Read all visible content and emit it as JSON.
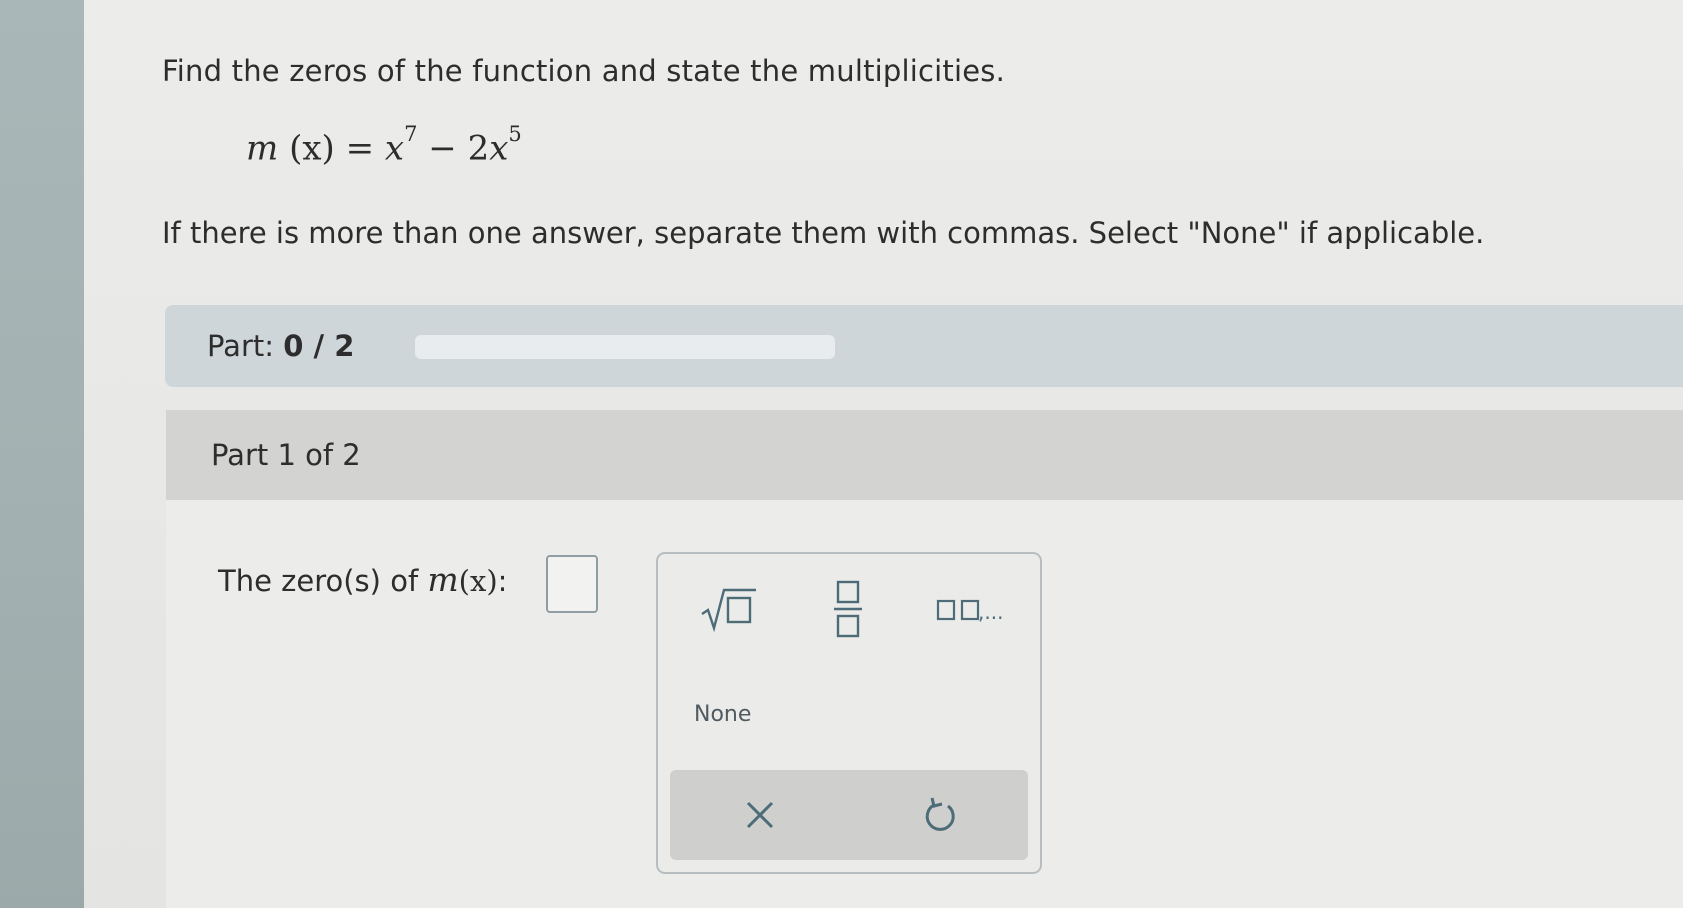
{
  "question": {
    "prompt": "Find the zeros of the function and state the multiplicities.",
    "function_name": "m",
    "function_var": "(x)",
    "equals": "=",
    "term1_base": "x",
    "term1_exp": "7",
    "minus": "−",
    "term2_coef": "2",
    "term2_base": "x",
    "term2_exp": "5",
    "instructions": "If there is more than one answer, separate them with commas. Select \"None\" if applicable."
  },
  "progress": {
    "label": "Part:",
    "value": "0 / 2",
    "fraction": 0
  },
  "part": {
    "title": "Part 1 of 2",
    "answer_label_prefix": "The zero(s) of",
    "answer_fn": "m",
    "answer_var": "(x)",
    "answer_label_suffix": ":",
    "answer_value": ""
  },
  "keypad": {
    "buttons": [
      "sqrt-icon",
      "fraction-icon",
      "list-icon"
    ],
    "list_suffix": ",...",
    "none_label": "None",
    "footer": [
      "close-icon",
      "undo-icon"
    ]
  },
  "colors": {
    "icon": "#4d6c78",
    "progress_band": "#cfd6da",
    "part_header": "#d3d3d1"
  }
}
